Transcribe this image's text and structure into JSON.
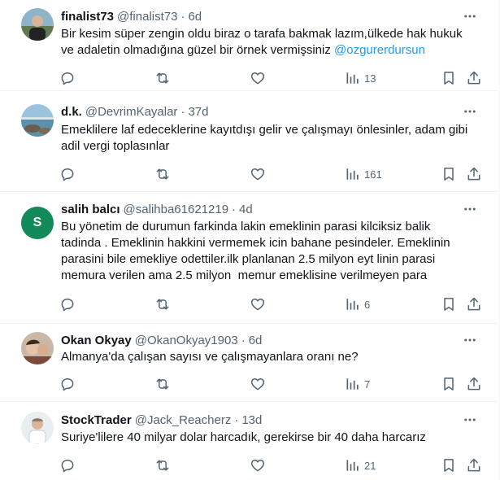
{
  "tweets": [
    {
      "name": "finalist73",
      "handle": "@finalist73",
      "dot": "·",
      "time": "6d",
      "lines": [
        "Bir kesim süper zengin oldu biraz o tarafa bakmak lazım,ülkede hak hukuk"
      ],
      "last_line_text": "ve adaletin olmadığına güzel bir örnek vermişsiniz ",
      "mention": "@ozgurerdursun",
      "views": "13"
    },
    {
      "name": "d.k.",
      "handle": "@DevrimKayalar",
      "dot": "·",
      "time": "37d",
      "lines": [
        "Emeklilere laf edeceklerine kayıtdışı gelir ve çalışmayı önlesinler, adam gibi",
        "adil vergi toplasınlar"
      ],
      "views": "161"
    },
    {
      "name": "salih balcı",
      "handle": "@salihba61621219",
      "dot": "·",
      "time": "4d",
      "avatar_letter": "S",
      "lines": [
        "Bu yönetim de durumun farkinda lakin emeklinin parasi kilciksiz balik",
        "tadinda . Emeklinin hakkini vermemek icin bahane pesindeler. Emeklinin",
        "parasini bile emekliye odettiler.ilk planlanan 2.5 milyon eyt linin parasi",
        "memura verilen ama 2.5 milyon  memur emeklisine verilmeyen para"
      ],
      "views": "6"
    },
    {
      "name": "Okan Okyay",
      "handle": "@OkanOkyay1903",
      "dot": "·",
      "time": "6d",
      "lines": [
        "Almanya'da çalışan sayısı ve çalışmayanlara oranı ne?"
      ],
      "views": "7"
    },
    {
      "name": "StockTrader",
      "handle": "@Jack_Reacherz",
      "dot": "·",
      "time": "13d",
      "lines": [
        "Suriye'lilere 40 milyar dolar harcadık, gerekirse bir 40 daha harcarız"
      ],
      "views": "21"
    }
  ],
  "icons": {
    "more": "more-icon",
    "reply": "reply-icon",
    "retweet": "retweet-icon",
    "like": "like-icon",
    "views": "views-icon",
    "bookmark": "bookmark-icon",
    "share": "share-icon"
  },
  "colors": {
    "text": "#0f1419",
    "secondary": "#536471",
    "link": "#1d9bf0",
    "avatar_green": "#138a5a",
    "divider": "#eff3f4"
  }
}
